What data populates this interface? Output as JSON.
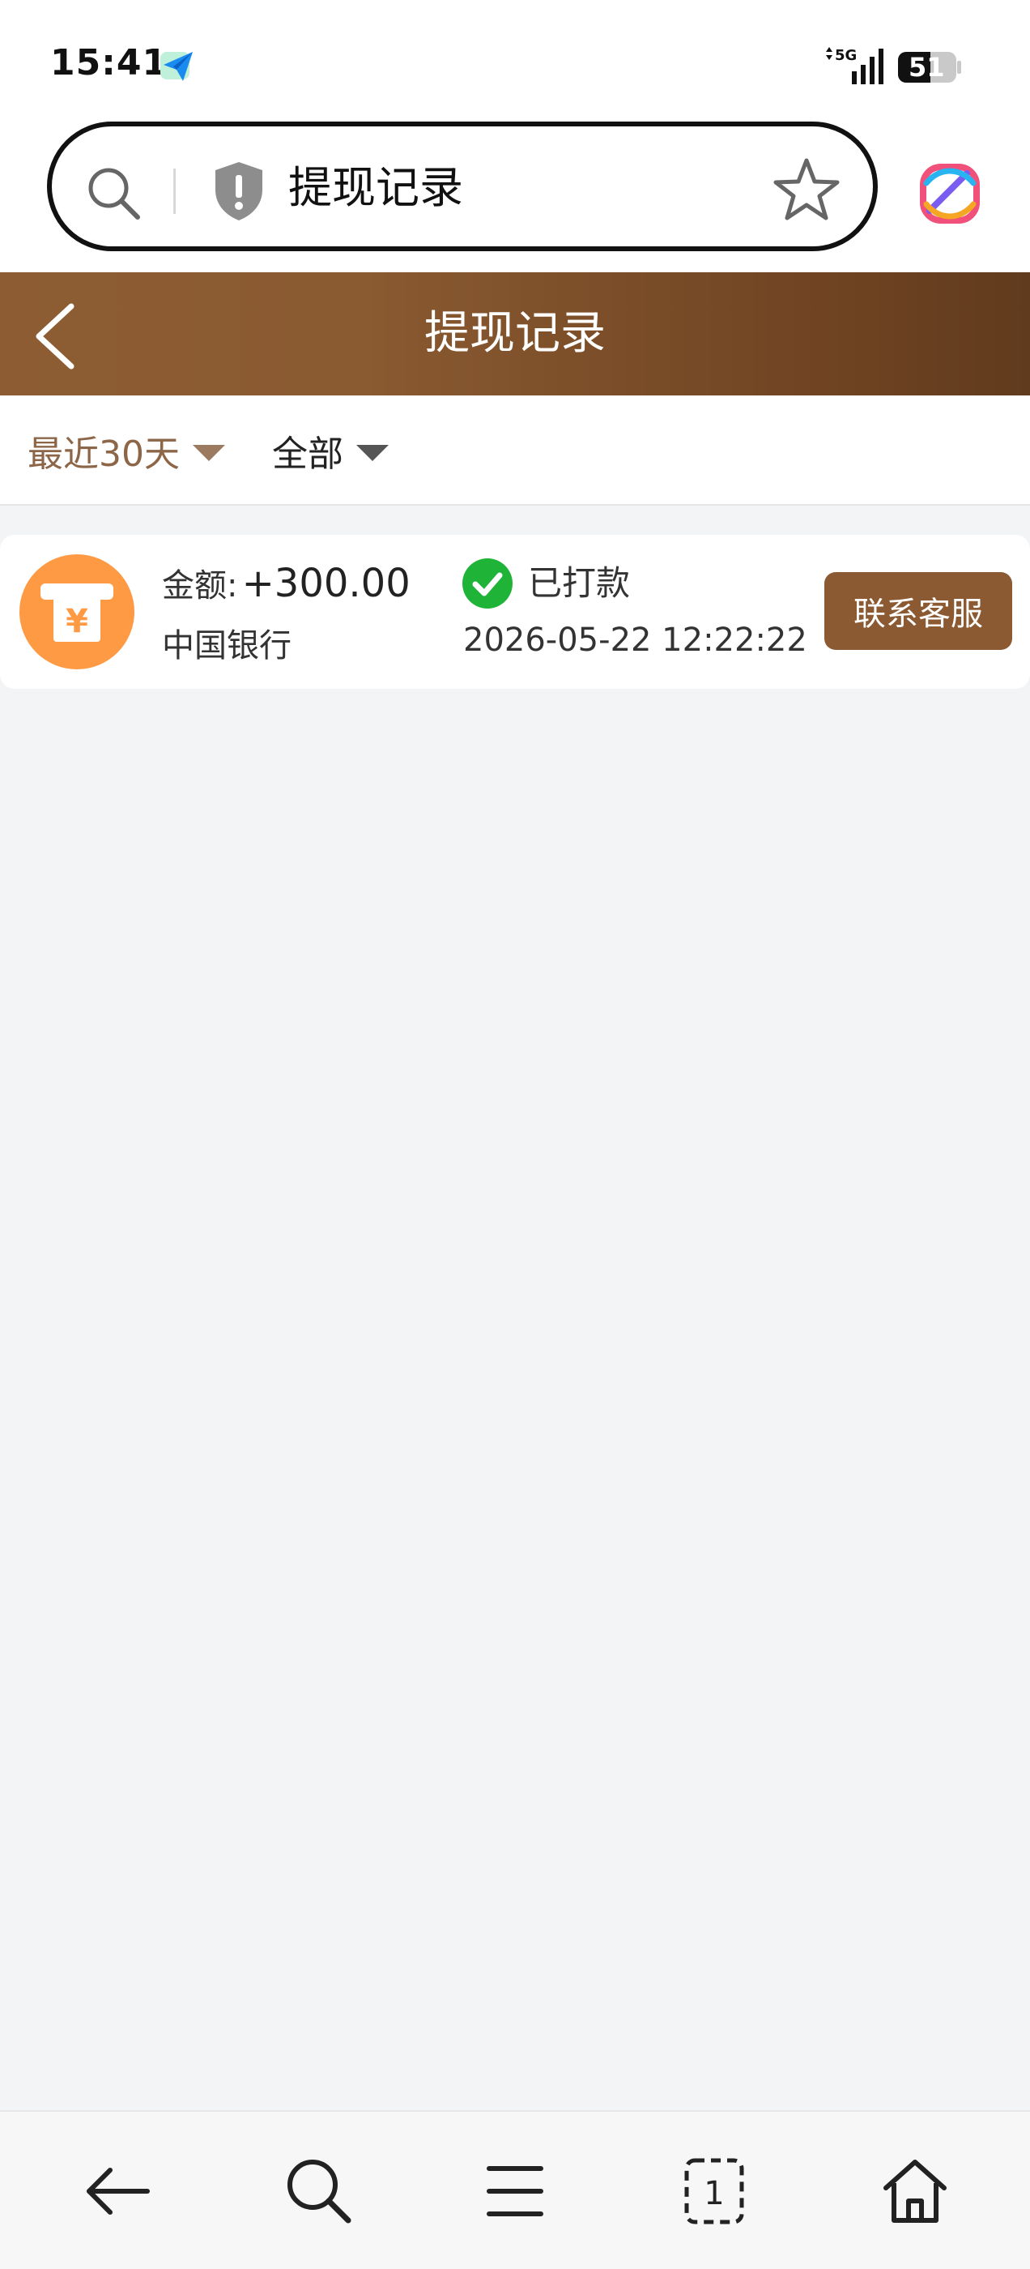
{
  "status_bar": {
    "time": "15:41",
    "network": "5G",
    "battery": "51"
  },
  "url_bar": {
    "text": "提现记录"
  },
  "header": {
    "title": "提现记录"
  },
  "filters": {
    "range": "最近30天",
    "status": "全部"
  },
  "records": [
    {
      "amount_label": "金额:",
      "amount": "+300.00",
      "bank": "中国银行",
      "status": "已打款",
      "time": "2026-05-22 12:22:22",
      "action_label": "联系客服"
    }
  ],
  "icons": {
    "back": "chevron-left-icon",
    "search": "search-icon",
    "shield": "shield-warning-icon",
    "star": "star-icon",
    "status": "check-circle-icon",
    "record": "atm-yuan-icon"
  },
  "colors": {
    "header_start": "#8d5c33",
    "header_end": "#613b1e",
    "accent_button": "#8c5a32",
    "filter_active": "#8d6648",
    "record_icon_bg": "#ff9a44",
    "success_green": "#1fb338"
  }
}
